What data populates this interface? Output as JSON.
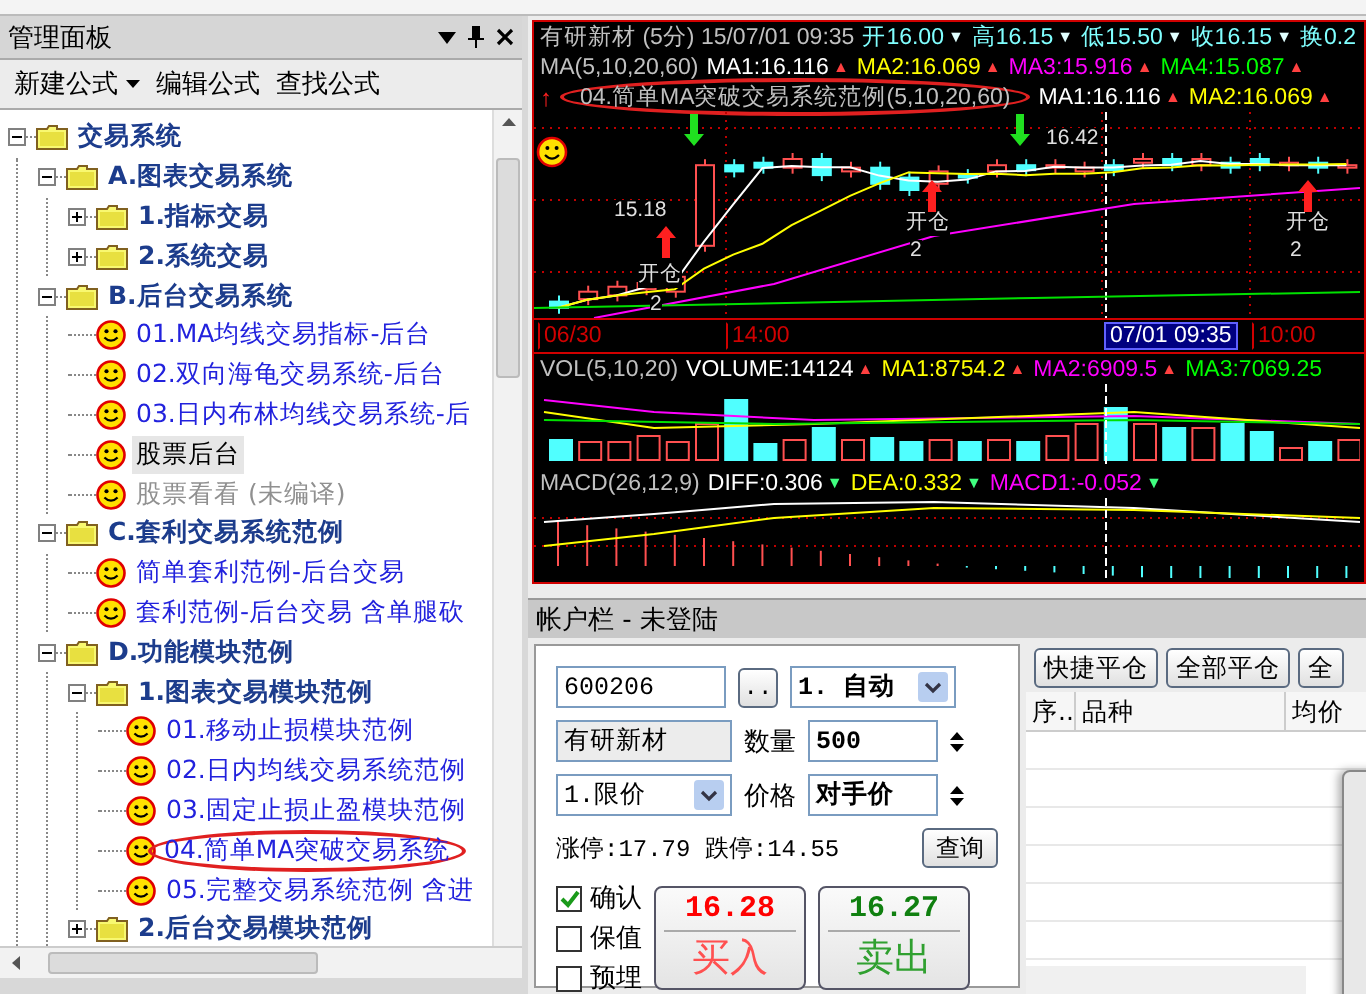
{
  "panel": {
    "title": "管理面板",
    "toolbar": [
      {
        "label": "新建公式",
        "dropdown": true
      },
      {
        "label": "编辑公式",
        "dropdown": false
      },
      {
        "label": "查找公式",
        "dropdown": false
      }
    ]
  },
  "tree": [
    {
      "kind": "folder",
      "label": "交易系统",
      "expanded": true,
      "children": [
        {
          "kind": "folder",
          "label": "A.图表交易系统",
          "expanded": true,
          "children": [
            {
              "kind": "folder",
              "label": "1.指标交易",
              "expanded": false
            },
            {
              "kind": "folder",
              "label": "2.系统交易",
              "expanded": false
            }
          ]
        },
        {
          "kind": "folder",
          "label": "B.后台交易系统",
          "expanded": true,
          "children": [
            {
              "kind": "formula",
              "label": "01.MA均线交易指标-后台",
              "selected": false,
              "disabled": false,
              "circled": false
            },
            {
              "kind": "formula",
              "label": "02.双向海龟交易系统-后台",
              "selected": false,
              "disabled": false,
              "circled": false
            },
            {
              "kind": "formula",
              "label": "03.日内布林均线交易系统-后",
              "selected": false,
              "disabled": false,
              "circled": false
            },
            {
              "kind": "formula",
              "label": "股票后台",
              "selected": true,
              "disabled": false,
              "circled": false
            },
            {
              "kind": "formula",
              "label": "股票看看 (未编译)",
              "selected": false,
              "disabled": true,
              "circled": false
            }
          ]
        },
        {
          "kind": "folder",
          "label": "C.套利交易系统范例",
          "expanded": true,
          "children": [
            {
              "kind": "formula",
              "label": "简单套利范例-后台交易",
              "selected": false,
              "disabled": false,
              "circled": false
            },
            {
              "kind": "formula",
              "label": "套利范例-后台交易 含单腿砍",
              "selected": false,
              "disabled": false,
              "circled": false
            }
          ]
        },
        {
          "kind": "folder",
          "label": "D.功能模块范例",
          "expanded": true,
          "children": [
            {
              "kind": "folder",
              "label": "1.图表交易模块范例",
              "expanded": true,
              "children": [
                {
                  "kind": "formula",
                  "label": "01.移动止损模块范例",
                  "selected": false,
                  "disabled": false,
                  "circled": false
                },
                {
                  "kind": "formula",
                  "label": "02.日内均线交易系统范例",
                  "selected": false,
                  "disabled": false,
                  "circled": false
                },
                {
                  "kind": "formula",
                  "label": "03.固定止损止盈模块范例",
                  "selected": false,
                  "disabled": false,
                  "circled": false
                },
                {
                  "kind": "formula",
                  "label": "04.简单MA突破交易系统",
                  "selected": false,
                  "disabled": false,
                  "circled": true
                },
                {
                  "kind": "formula",
                  "label": "05.完整交易系统范例 含进",
                  "selected": false,
                  "disabled": false,
                  "circled": false
                }
              ]
            },
            {
              "kind": "folder",
              "label": "2.后台交易模块范例",
              "expanded": false
            }
          ]
        }
      ]
    }
  ],
  "chart": {
    "price_header": [
      [
        {
          "text": "有研新材 (5分) 15/07/01 09:35",
          "color": "#c0c0c0",
          "circled": false
        },
        {
          "text": "开16.00",
          "color": "#80ffff",
          "arrow": {
            "glyph": "▼",
            "color": "#e0ffff"
          },
          "circled": false
        },
        {
          "text": "高16.15",
          "color": "#80ffff",
          "arrow": {
            "glyph": "▼",
            "color": "#e0ffff"
          },
          "circled": false
        },
        {
          "text": "低15.50",
          "color": "#80ffff",
          "arrow": {
            "glyph": "▼",
            "color": "#e0ffff"
          },
          "circled": false
        },
        {
          "text": "收16.15",
          "color": "#80ffff",
          "arrow": {
            "glyph": "▼",
            "color": "#e0ffff"
          },
          "circled": false
        },
        {
          "text": "换0.2",
          "color": "#80ffff",
          "circled": false
        }
      ],
      [
        {
          "text": "MA(5,10,20,60)",
          "color": "#c0c0c0",
          "circled": false
        },
        {
          "text": "MA1:16.116",
          "color": "#ffffff",
          "arrow": {
            "glyph": "▲",
            "color": "#ff4040"
          },
          "circled": false
        },
        {
          "text": "MA2:16.069",
          "color": "#ffff00",
          "arrow": {
            "glyph": "▲",
            "color": "#ff4040"
          },
          "circled": false
        },
        {
          "text": "MA3:15.916",
          "color": "#ff00ff",
          "arrow": {
            "glyph": "▲",
            "color": "#ff4040"
          },
          "circled": false
        },
        {
          "text": "MA4:15.087",
          "color": "#00ff00",
          "arrow": {
            "glyph": "▲",
            "color": "#ff4040"
          },
          "circled": false
        }
      ],
      [
        {
          "lead": "↑",
          "text": "04.简单MA突破交易系统范例(5,10,20,60)",
          "color": "#c0c0c0",
          "circled": true
        },
        {
          "text": "MA1:16.116",
          "color": "#ffffff",
          "arrow": {
            "glyph": "▲",
            "color": "#ff4040"
          },
          "circled": false
        },
        {
          "text": "MA2:16.069",
          "color": "#ffff00",
          "arrow": {
            "glyph": "▲",
            "color": "#ff4040"
          },
          "circled": false
        }
      ]
    ],
    "annotations": [
      {
        "text": "16.42"
      },
      {
        "text": "15.18"
      },
      {
        "text": "开仓"
      },
      {
        "text": "开仓"
      },
      {
        "text": "开仓"
      },
      {
        "text": "2"
      },
      {
        "text": "2"
      },
      {
        "text": "2"
      }
    ],
    "time_labels": [
      {
        "text": "06/30",
        "selected": false
      },
      {
        "text": "14:00",
        "selected": false
      },
      {
        "text": "07/01 09:35",
        "selected": true
      },
      {
        "text": "10:00",
        "selected": false
      }
    ],
    "volume_header": [
      {
        "text": "VOL(5,10,20)",
        "color": "#c0c0c0",
        "circled": false
      },
      {
        "text": "VOLUME:14124",
        "color": "#ffffff",
        "arrow": {
          "glyph": "▲",
          "color": "#ff4040"
        },
        "circled": false
      },
      {
        "text": "MA1:8754.2",
        "color": "#ffff00",
        "arrow": {
          "glyph": "▲",
          "color": "#ff4040"
        },
        "circled": false
      },
      {
        "text": "MA2:6909.5",
        "color": "#ff00ff",
        "arrow": {
          "glyph": "▲",
          "color": "#ff4040"
        },
        "circled": false
      },
      {
        "text": "MA3:7069.25",
        "color": "#00ff00",
        "circled": false
      }
    ],
    "macd_header": [
      {
        "text": "MACD(26,12,9)",
        "color": "#c0c0c0",
        "circled": false
      },
      {
        "text": "DIFF:0.306",
        "color": "#ffffff",
        "arrow": {
          "glyph": "▼",
          "color": "#40ff80"
        },
        "circled": false
      },
      {
        "text": "DEA:0.332",
        "color": "#ffff00",
        "arrow": {
          "glyph": "▼",
          "color": "#40ff80"
        },
        "circled": false
      },
      {
        "text": "MACD1:-0.052",
        "color": "#ff00ff",
        "arrow": {
          "glyph": "▼",
          "color": "#40ff80"
        },
        "circled": false
      }
    ]
  },
  "account": {
    "title": "帐户栏 - 未登陆",
    "order": {
      "code": "600206",
      "browse": "..",
      "mode": "1. 自动",
      "name": "有研新材",
      "qty_label": "数量",
      "qty": "500",
      "price_type": "1.限价",
      "price_label": "价格",
      "price": "对手价",
      "limits": "涨停:17.79 跌停:14.55",
      "query": "查询",
      "options": [
        {
          "label": "确认",
          "checked": true
        },
        {
          "label": "保值",
          "checked": false
        },
        {
          "label": "预埋",
          "checked": false
        }
      ],
      "trade_buttons": [
        {
          "kind": "buy",
          "price": "16.28",
          "label": "买入"
        },
        {
          "kind": "sell",
          "price": "16.27",
          "label": "卖出"
        }
      ]
    },
    "positions": {
      "buttons": [
        "快捷平仓",
        "全部平仓",
        "全"
      ],
      "columns": [
        "序..",
        "品种",
        "均价"
      ]
    }
  }
}
